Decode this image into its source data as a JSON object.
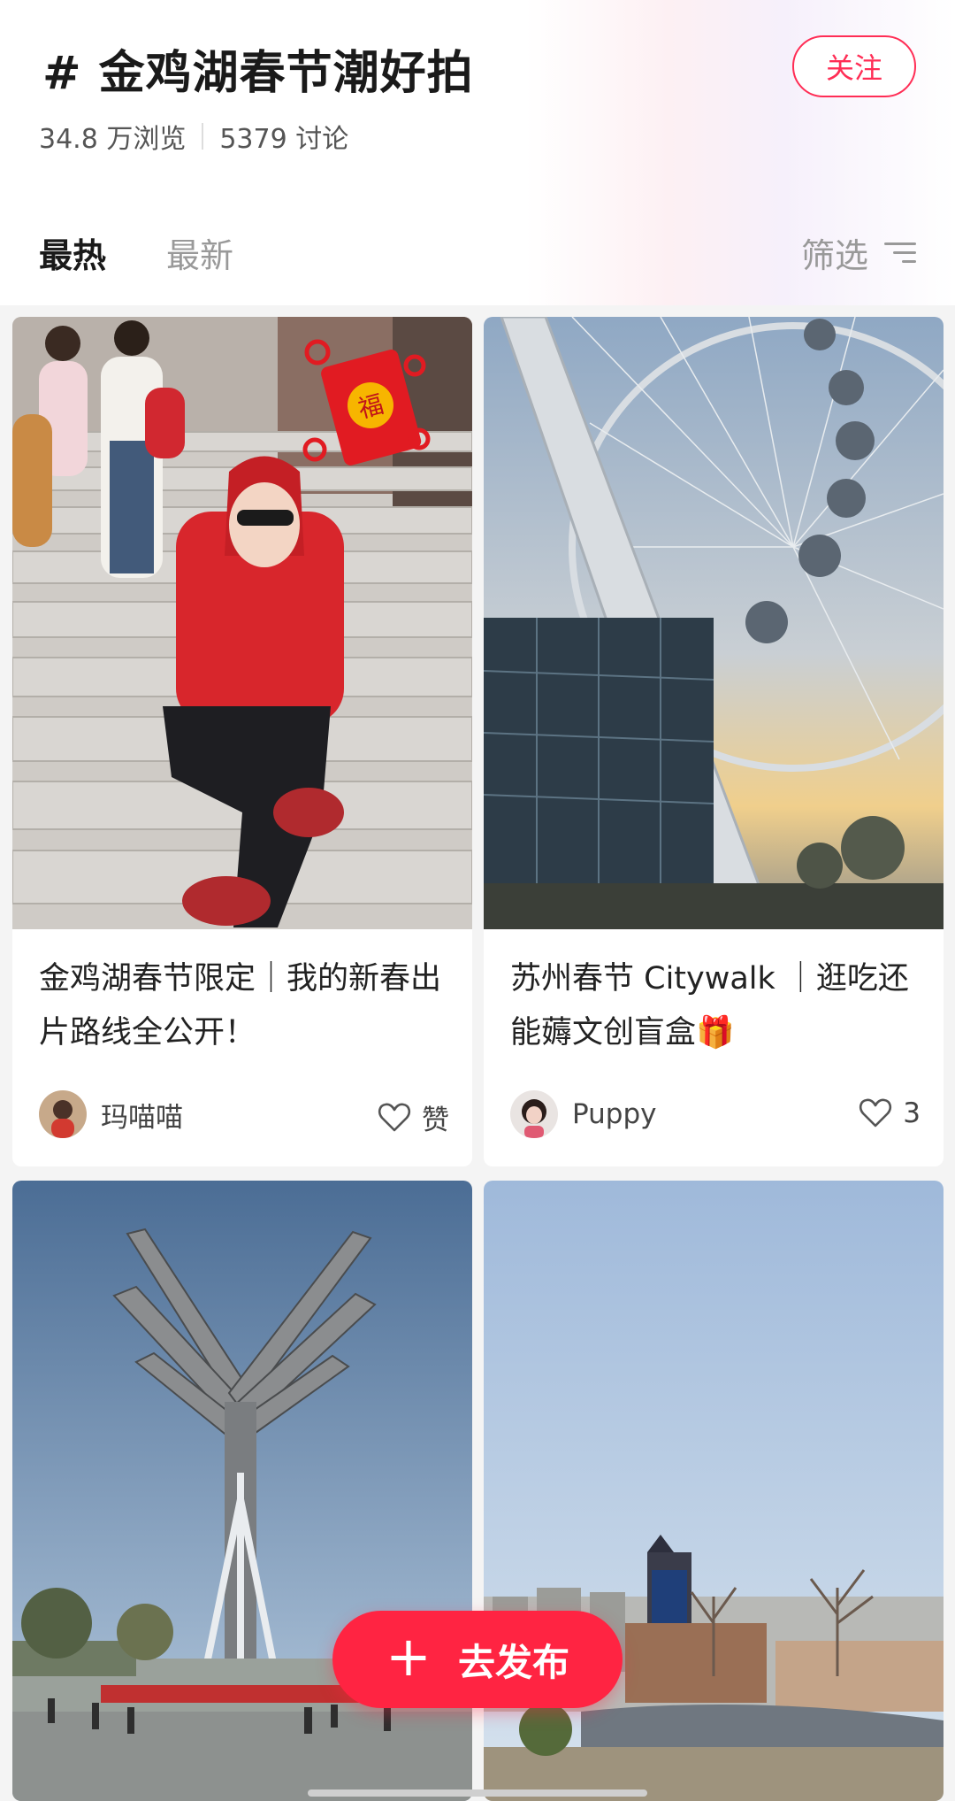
{
  "topic": {
    "title": "# 金鸡湖春节潮好拍",
    "follow_label": "关注",
    "views": "34.8 万浏览",
    "discussions": "5379 讨论"
  },
  "tabs": [
    {
      "label": "最热",
      "active": true
    },
    {
      "label": "最新",
      "active": false
    }
  ],
  "filter_label": "筛选",
  "posts": [
    {
      "title": "金鸡湖春节限定｜我的新春出片路线全公开！",
      "author": "玛喵喵",
      "likes": "赞",
      "avatar_icon": "user-avatar"
    },
    {
      "title": "苏州春节 Citywalk ｜逛吃还能薅文创盲盒🎁",
      "author": "Puppy",
      "likes": "3",
      "avatar_icon": "user-avatar"
    },
    {
      "image": "wing-sculpture-photo"
    },
    {
      "image": "waterfront-skyline-photo"
    }
  ],
  "publish": {
    "label": "去发布",
    "icon": "plus-icon"
  },
  "colors": {
    "accent": "#ff2442"
  }
}
